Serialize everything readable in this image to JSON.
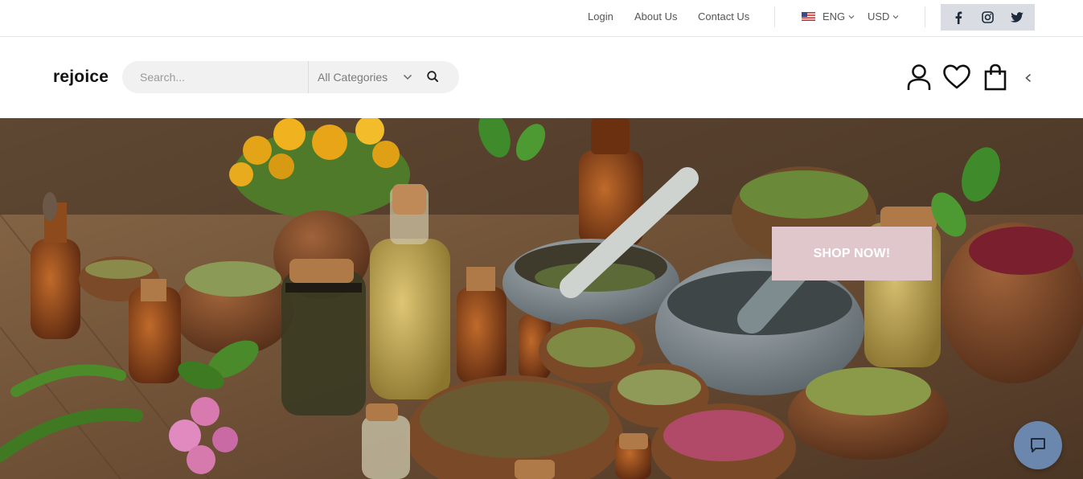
{
  "topbar": {
    "links": {
      "login": "Login",
      "about": "About Us",
      "contact": "Contact Us"
    },
    "language": {
      "label": "ENG",
      "flag": "us-flag-icon"
    },
    "currency": {
      "label": "USD"
    },
    "social": [
      "facebook-icon",
      "instagram-icon",
      "twitter-icon"
    ]
  },
  "header": {
    "logo": "rejoice",
    "search": {
      "placeholder": "Search...",
      "value": ""
    },
    "category": {
      "selected": "All Categories"
    },
    "icons": [
      "user-icon",
      "heart-icon",
      "shopping-bag-icon",
      "chevron-left-icon"
    ]
  },
  "hero": {
    "cta_label": "SHOP NOW!",
    "image": "herbal-apothecary-image"
  },
  "chat": {
    "icon": "chat-icon"
  },
  "colors": {
    "cta_bg": "#dfc7cb",
    "chat_bg": "#6c87ad",
    "social_bg": "#d9dce3"
  }
}
